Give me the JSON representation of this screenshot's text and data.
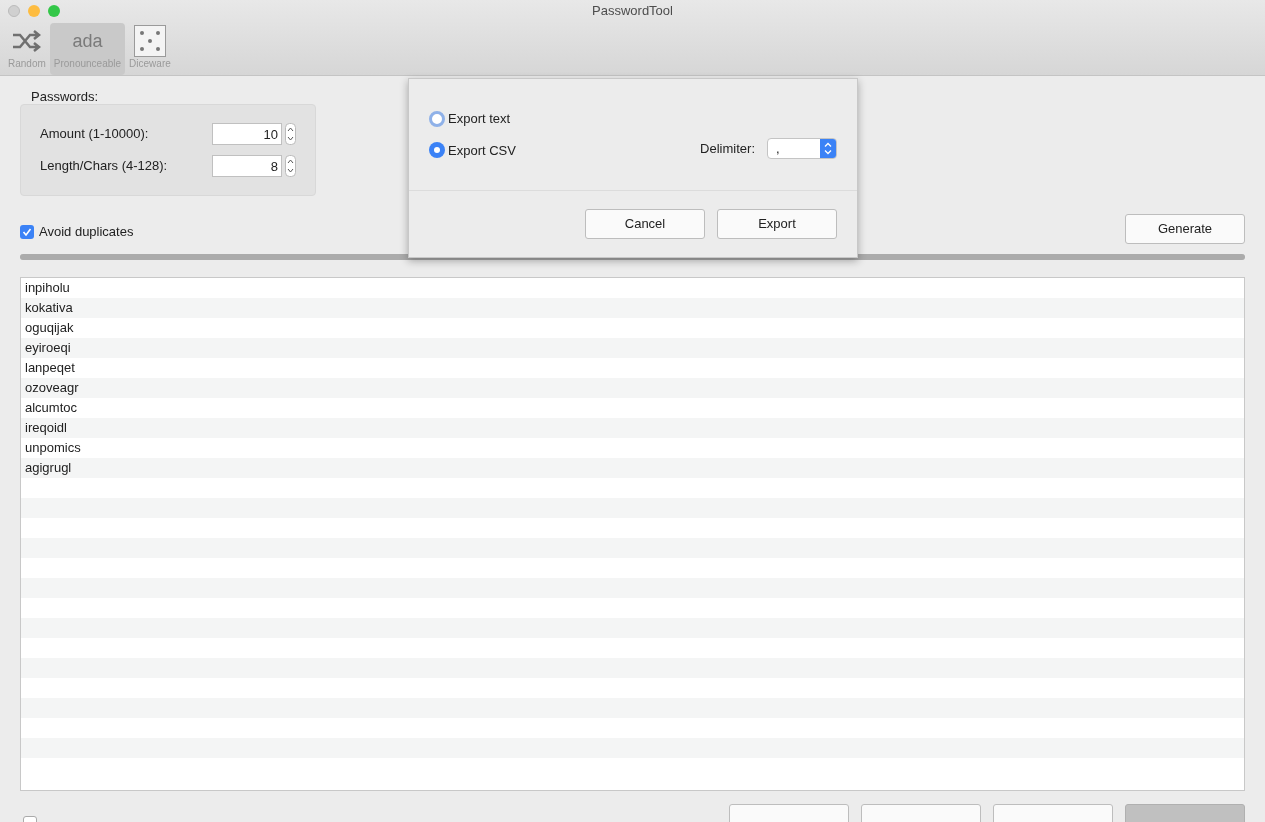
{
  "window": {
    "title": "PasswordTool"
  },
  "toolbar": [
    {
      "kind": "shuffle",
      "label": "Random",
      "selected": false
    },
    {
      "kind": "text",
      "glyph": "ada",
      "label": "Pronounceable",
      "selected": true
    },
    {
      "kind": "dice",
      "label": "Diceware",
      "selected": false
    }
  ],
  "passwords_group": {
    "title": "Passwords:",
    "fields": [
      {
        "label": "Amount (1-10000):",
        "value": "10"
      },
      {
        "label": "Length/Chars (4-128):",
        "value": "8"
      }
    ]
  },
  "avoid_duplicates": {
    "label": "Avoid duplicates",
    "checked": true
  },
  "generate_button": "Generate",
  "progress": {
    "level": 1
  },
  "passwords": [
    "inpiholu",
    "kokativa",
    "oguqijak",
    "eyiroeqi",
    "lanpeqet",
    "ozoveagr",
    "alcumtoc",
    "ireqoidl",
    "unpomics",
    "agigrugl"
  ],
  "bottom": {
    "checkbox_checked": false,
    "buttons": [
      {
        "selected": false
      },
      {
        "selected": false
      },
      {
        "selected": false
      },
      {
        "selected": true
      }
    ]
  },
  "export_sheet": {
    "options": [
      {
        "label": "Export text",
        "selected": false
      },
      {
        "label": "Export CSV",
        "selected": true
      }
    ],
    "delimiter_label": "Delimiter:",
    "delimiter_value": ",",
    "buttons": [
      "Cancel",
      "Export"
    ]
  }
}
